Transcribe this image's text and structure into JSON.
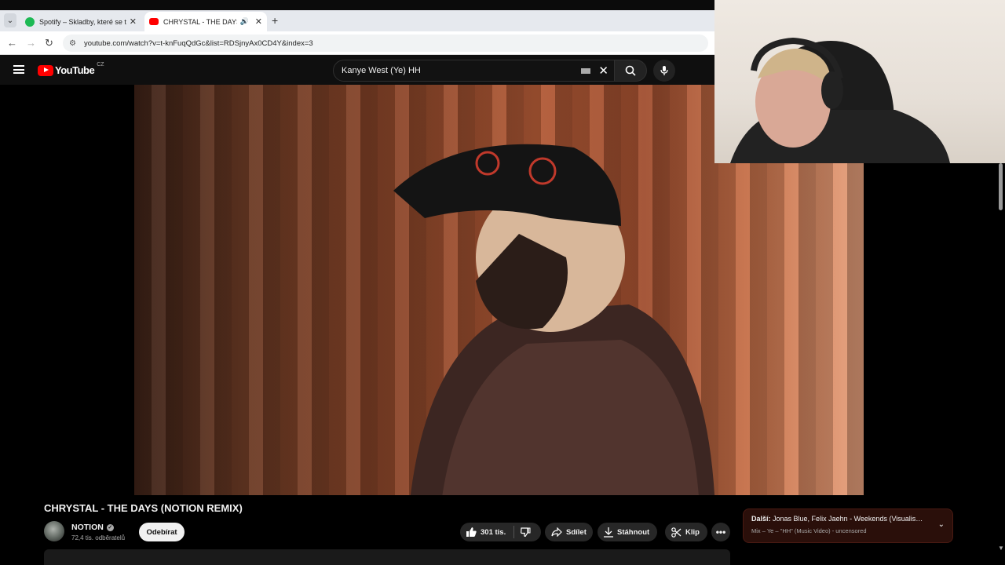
{
  "browser": {
    "tabs": [
      {
        "title": "Spotify – Skladby, které se ti líbí",
        "favicon_color": "#1db954"
      },
      {
        "title": "CHRYSTAL - THE DAYS (NOTION REMIX)",
        "favicon_color": "#ff0000",
        "active": true
      }
    ],
    "url": "youtube.com/watch?v=t-knFuqQdGc&list=RDSjnyAx0CD4Y&index=3"
  },
  "youtube": {
    "logo_text": "YouTube",
    "country_code": "CZ",
    "search_query": "Kanye West (Ye) HH"
  },
  "video": {
    "title": "CHRYSTAL - THE DAYS (NOTION REMIX)",
    "channel": "NOTION",
    "subscribers": "72,4 tis. odběratelů",
    "subscribe_label": "Odebírat",
    "likes": "301 tis.",
    "share_label": "Sdílet",
    "download_label": "Stáhnout",
    "clip_label": "Klip",
    "more_label": "•••"
  },
  "up_next": {
    "prefix": "Další:",
    "title": "Jonas Blue, Felix Jaehn - Weekends (Visualis…",
    "subtitle": "Mix – Ye – \"HH\" (Music Video) - uncensored"
  },
  "colors": {
    "yt_bg": "#0f0f0f",
    "accent_red": "#ff0000",
    "pill_bg": "#272727"
  }
}
